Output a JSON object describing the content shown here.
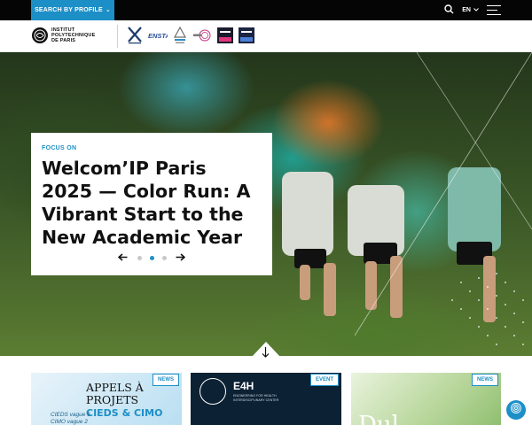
{
  "topbar": {
    "search_label": "SEARCH BY PROFILE",
    "language": "EN"
  },
  "header": {
    "logo_lines": [
      "INSTITUT",
      "POLYTECHNIQUE",
      "DE PARIS"
    ],
    "schools": [
      "École polytechnique",
      "ENSTA",
      "École des Ponts",
      "ENSAE",
      "Télécom Paris",
      "Télécom SudParis"
    ]
  },
  "hero": {
    "kicker": "FOCUS ON",
    "title": "Welcom’IP Paris 2025 — Color Run: A Vibrant Start to the New Academic Year",
    "slide_count": 3,
    "active_slide": 2
  },
  "news": [
    {
      "badge": "NEWS",
      "heading": "APPELS À PROJETS",
      "heading_accent": "CIEDS & CIMO",
      "sub_lines": [
        "CIEDS vague 6",
        "CIMO vague 2"
      ]
    },
    {
      "badge": "EVENT",
      "heading": "E4H",
      "sub": "ENGINEERING FOR HEALTH INTERDISCIPLINARY CENTER"
    },
    {
      "badge": "NEWS",
      "big_text": "Dul"
    }
  ],
  "colors": {
    "accent": "#1d8fc7",
    "topbar": "#050505"
  }
}
